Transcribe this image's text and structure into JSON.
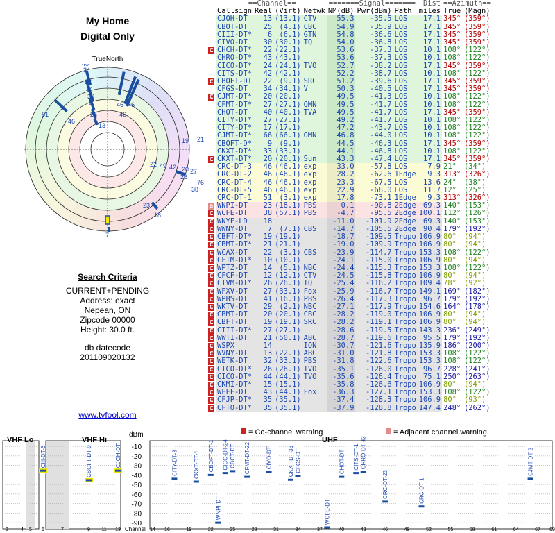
{
  "page": {
    "title": "My Home",
    "subtitle": "Digital Only",
    "compass_label": "TrueNorth",
    "site_link": "www.tvfool.com"
  },
  "criteria": {
    "header": "Search Criteria",
    "lines": [
      "CURRENT+PENDING",
      "Address: exact",
      "Nepean, ON",
      "Zipcode 00000",
      "Height: 30.0 ft."
    ],
    "datecode_label": "db datecode",
    "datecode": "201109020132"
  },
  "table": {
    "group_headers": {
      "channel": "==Channel==",
      "signal": "=======Signal=======",
      "dist": "Dist",
      "azimuth": "==Azimuth=="
    },
    "columns": [
      "Callsign",
      "Real",
      "(Virt)",
      "Netwk",
      "NM(dB)",
      "Pwr(dBm)",
      "Path",
      "miles",
      "True",
      "(Magn)"
    ],
    "rows": [
      {
        "mark": "",
        "color": "green",
        "cs": "CJOH-DT",
        "real": "13",
        "virt": "(13.1)",
        "net": "CTV",
        "nm": "55.3",
        "pwr": "-35.5",
        "path": "LOS",
        "dist": "17.1",
        "az": "345°",
        "mag": "(359°)"
      },
      {
        "mark": "",
        "color": "green",
        "cs": "CBOT-DT",
        "real": "25",
        "virt": "(4.1)",
        "net": "CBC",
        "nm": "54.9",
        "pwr": "-35.9",
        "path": "LOS",
        "dist": "17.1",
        "az": "345°",
        "mag": "(359°)"
      },
      {
        "mark": "",
        "color": "green",
        "cs": "CIII-DT*",
        "real": "6",
        "virt": "(6.1)",
        "net": "GTN",
        "nm": "54.8",
        "pwr": "-36.6",
        "path": "LOS",
        "dist": "17.1",
        "az": "345°",
        "mag": "(359°)"
      },
      {
        "mark": "",
        "color": "green",
        "cs": "CIVO-DT",
        "real": "30",
        "virt": "(30.1)",
        "net": "TQ",
        "nm": "54.0",
        "pwr": "-36.8",
        "path": "LOS",
        "dist": "17.1",
        "az": "345°",
        "mag": "(359°)"
      },
      {
        "mark": "C",
        "color": "green",
        "cs": "CHCH-DT*",
        "real": "22",
        "virt": "(22.1)",
        "net": "",
        "nm": "53.6",
        "pwr": "-37.3",
        "path": "LOS",
        "dist": "10.1",
        "az": "108°",
        "mag": "(122°)"
      },
      {
        "mark": "",
        "color": "green",
        "cs": "CHRO-DT*",
        "real": "43",
        "virt": "(43.1)",
        "net": "",
        "nm": "53.6",
        "pwr": "-37.3",
        "path": "LOS",
        "dist": "10.1",
        "az": "108°",
        "mag": "(122°)"
      },
      {
        "mark": "",
        "color": "green",
        "cs": "CICO-DT*",
        "real": "24",
        "virt": "(24.1)",
        "net": "TVO",
        "nm": "52.7",
        "pwr": "-38.2",
        "path": "LOS",
        "dist": "17.1",
        "az": "345°",
        "mag": "(359°)"
      },
      {
        "mark": "",
        "color": "green",
        "cs": "CITS-DT*",
        "real": "42",
        "virt": "(42.1)",
        "net": "",
        "nm": "52.2",
        "pwr": "-38.7",
        "path": "LOS",
        "dist": "10.1",
        "az": "108°",
        "mag": "(122°)"
      },
      {
        "mark": "C",
        "color": "green",
        "cs": "CBOFT-DT",
        "real": "22",
        "virt": "(9.1)",
        "net": "SRC",
        "nm": "51.2",
        "pwr": "-39.6",
        "path": "LOS",
        "dist": "17.1",
        "az": "345°",
        "mag": "(359°)"
      },
      {
        "mark": "",
        "color": "green",
        "cs": "CFGS-DT",
        "real": "34",
        "virt": "(34.1)",
        "net": "V",
        "nm": "50.3",
        "pwr": "-40.5",
        "path": "LOS",
        "dist": "17.1",
        "az": "345°",
        "mag": "(359°)"
      },
      {
        "mark": "C",
        "color": "green",
        "cs": "CJMT-DT*",
        "real": "20",
        "virt": "(20.1)",
        "net": "",
        "nm": "49.5",
        "pwr": "-41.3",
        "path": "LOS",
        "dist": "10.1",
        "az": "108°",
        "mag": "(122°)"
      },
      {
        "mark": "",
        "color": "green",
        "cs": "CFMT-DT*",
        "real": "27",
        "virt": "(27.1)",
        "net": "OMN",
        "nm": "49.5",
        "pwr": "-41.7",
        "path": "LOS",
        "dist": "10.1",
        "az": "108°",
        "mag": "(122°)"
      },
      {
        "mark": "",
        "color": "green",
        "cs": "CHOT-DT",
        "real": "40",
        "virt": "(40.1)",
        "net": "TVA",
        "nm": "49.5",
        "pwr": "-41.7",
        "path": "LOS",
        "dist": "17.1",
        "az": "345°",
        "mag": "(359°)"
      },
      {
        "mark": "",
        "color": "green",
        "cs": "CITY-DT*",
        "real": "27",
        "virt": "(27.1)",
        "net": "",
        "nm": "49.2",
        "pwr": "-41.7",
        "path": "LOS",
        "dist": "10.1",
        "az": "108°",
        "mag": "(122°)"
      },
      {
        "mark": "",
        "color": "green",
        "cs": "CITY-DT*",
        "real": "17",
        "virt": "(17.1)",
        "net": "",
        "nm": "47.2",
        "pwr": "-43.7",
        "path": "LOS",
        "dist": "10.1",
        "az": "108°",
        "mag": "(122°)"
      },
      {
        "mark": "",
        "color": "green",
        "cs": "CJMT-DT*",
        "real": "66",
        "virt": "(66.1)",
        "net": "OMN",
        "nm": "46.8",
        "pwr": "-44.0",
        "path": "LOS",
        "dist": "10.1",
        "az": "108°",
        "mag": "(122°)"
      },
      {
        "mark": "",
        "color": "green",
        "cs": "CBOFT-D*",
        "real": "9",
        "virt": "(9.1)",
        "net": "",
        "nm": "44.5",
        "pwr": "-46.3",
        "path": "LOS",
        "dist": "17.1",
        "az": "345°",
        "mag": "(359°)"
      },
      {
        "mark": "",
        "color": "green",
        "cs": "CKXT-DT*",
        "real": "33",
        "virt": "(33.1)",
        "net": "",
        "nm": "44.1",
        "pwr": "-46.8",
        "path": "LOS",
        "dist": "10.1",
        "az": "108°",
        "mag": "(122°)"
      },
      {
        "mark": "C",
        "color": "green",
        "cs": "CKXT-DT*",
        "real": "20",
        "virt": "(20.1)",
        "net": "Sun",
        "nm": "43.3",
        "pwr": "-47.4",
        "path": "LOS",
        "dist": "17.1",
        "az": "345°",
        "mag": "(359°)"
      },
      {
        "mark": "",
        "color": "yellow",
        "cs": "CRC-DT-3",
        "real": "46",
        "virt": "(46.1)",
        "net": "exp",
        "nm": "33.0",
        "pwr": "-57.8",
        "path": "LOS",
        "dist": "7.9",
        "az": "21°",
        "mag": "(34°)"
      },
      {
        "mark": "",
        "color": "yellow",
        "cs": "CRC-DT-2",
        "real": "46",
        "virt": "(46.1)",
        "net": "exp",
        "nm": "28.2",
        "pwr": "-62.6",
        "path": "1Edge",
        "dist": "9.3",
        "az": "313°",
        "mag": "(326°)"
      },
      {
        "mark": "",
        "color": "yellow",
        "cs": "CRC-DT-4",
        "real": "46",
        "virt": "(46.1)",
        "net": "exp",
        "nm": "23.3",
        "pwr": "-67.5",
        "path": "LOS",
        "dist": "13.6",
        "az": "24°",
        "mag": "(38°)"
      },
      {
        "mark": "",
        "color": "yellow",
        "cs": "CRC-DT-5",
        "real": "46",
        "virt": "(46.1)",
        "net": "exp",
        "nm": "22.9",
        "pwr": "-68.0",
        "path": "LOS",
        "dist": "11.7",
        "az": "12°",
        "mag": "(25°)"
      },
      {
        "mark": "",
        "color": "yellow",
        "cs": "CRC-DT-1",
        "real": "51",
        "virt": "(3.1)",
        "net": "exp",
        "nm": "17.8",
        "pwr": "-73.1",
        "path": "1Edge",
        "dist": "9.3",
        "az": "313°",
        "mag": "(326°)"
      },
      {
        "mark": "a",
        "color": "pink",
        "cs": "WNPI-DT",
        "real": "23",
        "virt": "(18.1)",
        "net": "PBS",
        "nm": "0.1",
        "pwr": "-90.8",
        "path": "2Edge",
        "dist": "69.3",
        "az": "140°",
        "mag": "(153°)"
      },
      {
        "mark": "C",
        "color": "pink",
        "cs": "WCFE-DT",
        "real": "38",
        "virt": "(57.1)",
        "net": "PBS",
        "nm": "-4.7",
        "pwr": "-95.5",
        "path": "2Edge",
        "dist": "100.1",
        "az": "112°",
        "mag": "(126°)"
      },
      {
        "mark": "C",
        "color": "gray",
        "cs": "WNYF-LD",
        "real": "18",
        "virt": "",
        "net": "",
        "nm": "-11.0",
        "pwr": "-101.9",
        "path": "2Edge",
        "dist": "69.3",
        "az": "140°",
        "mag": "(153°)"
      },
      {
        "mark": "C",
        "color": "gray",
        "cs": "WWNY-DT",
        "real": "7",
        "virt": "(7.1)",
        "net": "CBS",
        "nm": "-14.7",
        "pwr": "-105.5",
        "path": "2Edge",
        "dist": "90.4",
        "az": "179°",
        "mag": "(192°)"
      },
      {
        "mark": "C",
        "color": "gray",
        "cs": "CBFT-DT*",
        "real": "19",
        "virt": "(19.1)",
        "net": "",
        "nm": "-18.7",
        "pwr": "-109.5",
        "path": "Tropo",
        "dist": "106.9",
        "az": "80°",
        "mag": "(94°)"
      },
      {
        "mark": "C",
        "color": "gray",
        "cs": "CBMT-DT*",
        "real": "21",
        "virt": "(21.1)",
        "net": "",
        "nm": "-19.0",
        "pwr": "-109.9",
        "path": "Tropo",
        "dist": "106.9",
        "az": "80°",
        "mag": "(94°)"
      },
      {
        "mark": "C",
        "color": "gray",
        "cs": "WCAX-DT",
        "real": "22",
        "virt": "(3.1)",
        "net": "CBS",
        "nm": "-23.9",
        "pwr": "-114.7",
        "path": "Tropo",
        "dist": "153.3",
        "az": "108°",
        "mag": "(122°)"
      },
      {
        "mark": "C",
        "color": "gray",
        "cs": "CFTM-DT*",
        "real": "10",
        "virt": "(10.1)",
        "net": "",
        "nm": "-24.1",
        "pwr": "-115.0",
        "path": "Tropo",
        "dist": "106.9",
        "az": "80°",
        "mag": "(94°)"
      },
      {
        "mark": "C",
        "color": "gray",
        "cs": "WPTZ-DT",
        "real": "14",
        "virt": "(5.1)",
        "net": "NBC",
        "nm": "-24.4",
        "pwr": "-115.3",
        "path": "Tropo",
        "dist": "153.3",
        "az": "108°",
        "mag": "(122°)"
      },
      {
        "mark": "C",
        "color": "gray",
        "cs": "CFCF-DT",
        "real": "12",
        "virt": "(12.1)",
        "net": "CTV",
        "nm": "-24.5",
        "pwr": "-115.8",
        "path": "Tropo",
        "dist": "106.9",
        "az": "80°",
        "mag": "(94°)"
      },
      {
        "mark": "C",
        "color": "gray",
        "cs": "CIVM-DT*",
        "real": "26",
        "virt": "(26.1)",
        "net": "TQ",
        "nm": "-25.4",
        "pwr": "-116.2",
        "path": "Tropo",
        "dist": "109.4",
        "az": "78°",
        "mag": "(92°)"
      },
      {
        "mark": "C",
        "color": "gray",
        "cs": "WFXV-DT",
        "real": "27",
        "virt": "(33.1)",
        "net": "Fox",
        "nm": "-25.9",
        "pwr": "-116.7",
        "path": "Tropo",
        "dist": "149.1",
        "az": "169°",
        "mag": "(182°)"
      },
      {
        "mark": "C",
        "color": "gray",
        "cs": "WPBS-DT",
        "real": "41",
        "virt": "(16.1)",
        "net": "PBS",
        "nm": "-26.4",
        "pwr": "-117.3",
        "path": "Tropo",
        "dist": "96.7",
        "az": "179°",
        "mag": "(192°)"
      },
      {
        "mark": "C",
        "color": "gray",
        "cs": "WKTV-DT",
        "real": "29",
        "virt": "(2.1)",
        "net": "NBC",
        "nm": "-27.1",
        "pwr": "-117.9",
        "path": "Tropo",
        "dist": "154.6",
        "az": "164°",
        "mag": "(178°)"
      },
      {
        "mark": "C",
        "color": "gray",
        "cs": "CBMT-DT",
        "real": "20",
        "virt": "(20.1)",
        "net": "CBC",
        "nm": "-28.2",
        "pwr": "-119.0",
        "path": "Tropo",
        "dist": "106.9",
        "az": "80°",
        "mag": "(94°)"
      },
      {
        "mark": "C",
        "color": "gray",
        "cs": "CBFT-DT",
        "real": "19",
        "virt": "(19.1)",
        "net": "SRC",
        "nm": "-28.2",
        "pwr": "-119.1",
        "path": "Tropo",
        "dist": "106.9",
        "az": "80°",
        "mag": "(94°)"
      },
      {
        "mark": "C",
        "color": "gray",
        "cs": "CIII-DT*",
        "real": "27",
        "virt": "(27.1)",
        "net": "",
        "nm": "-28.6",
        "pwr": "-119.5",
        "path": "Tropo",
        "dist": "143.3",
        "az": "236°",
        "mag": "(249°)"
      },
      {
        "mark": "C",
        "color": "gray",
        "cs": "WWTI-DT",
        "real": "21",
        "virt": "(50.1)",
        "net": "ABC",
        "nm": "-28.7",
        "pwr": "-119.6",
        "path": "Tropo",
        "dist": "95.5",
        "az": "179°",
        "mag": "(192°)"
      },
      {
        "mark": "C",
        "color": "gray",
        "cs": "WSPX",
        "real": "14",
        "virt": "",
        "net": "ION",
        "nm": "-30.7",
        "pwr": "-121.6",
        "path": "Tropo",
        "dist": "135.9",
        "az": "186°",
        "mag": "(200°)"
      },
      {
        "mark": "C",
        "color": "gray",
        "cs": "WVNY-DT",
        "real": "13",
        "virt": "(22.1)",
        "net": "ABC",
        "nm": "-31.0",
        "pwr": "-121.8",
        "path": "Tropo",
        "dist": "153.3",
        "az": "108°",
        "mag": "(122°)"
      },
      {
        "mark": "C",
        "color": "gray",
        "cs": "WETK-DT",
        "real": "32",
        "virt": "(33.1)",
        "net": "PBS",
        "nm": "-31.8",
        "pwr": "-122.6",
        "path": "Tropo",
        "dist": "153.3",
        "az": "108°",
        "mag": "(122°)"
      },
      {
        "mark": "C",
        "color": "gray",
        "cs": "CICO-DT*",
        "real": "26",
        "virt": "(26.1)",
        "net": "TVO",
        "nm": "-35.1",
        "pwr": "-126.0",
        "path": "Tropo",
        "dist": "96.7",
        "az": "228°",
        "mag": "(241°)"
      },
      {
        "mark": "C",
        "color": "gray",
        "cs": "CICO-DT*",
        "real": "44",
        "virt": "(44.1)",
        "net": "TVO",
        "nm": "-35.6",
        "pwr": "-126.4",
        "path": "Tropo",
        "dist": "75.1",
        "az": "250°",
        "mag": "(263°)"
      },
      {
        "mark": "C",
        "color": "gray",
        "cs": "CKMI-DT*",
        "real": "15",
        "virt": "(15.1)",
        "net": "",
        "nm": "-35.8",
        "pwr": "-126.6",
        "path": "Tropo",
        "dist": "106.9",
        "az": "80°",
        "mag": "(94°)"
      },
      {
        "mark": "C",
        "color": "gray",
        "cs": "WFFF-DT",
        "real": "43",
        "virt": "(44.1)",
        "net": "Fox",
        "nm": "-36.3",
        "pwr": "-127.1",
        "path": "Tropo",
        "dist": "153.3",
        "az": "108°",
        "mag": "(122°)"
      },
      {
        "mark": "C",
        "color": "gray",
        "cs": "CFJP-DT*",
        "real": "35",
        "virt": "(35.1)",
        "net": "",
        "nm": "-37.4",
        "pwr": "-128.3",
        "path": "Tropo",
        "dist": "106.9",
        "az": "80°",
        "mag": "(93°)"
      },
      {
        "mark": "C",
        "color": "gray",
        "cs": "CFTO-DT*",
        "real": "35",
        "virt": "(35.1)",
        "net": "",
        "nm": "-37.9",
        "pwr": "-128.8",
        "path": "Tropo",
        "dist": "147.4",
        "az": "248°",
        "mag": "(262°)"
      }
    ]
  },
  "colors": {
    "az_345": "#b00000",
    "az_108": "#208020",
    "az_far": "#1a1aa0",
    "az_80": "#7fa000",
    "link": "#0000cc",
    "bar": "#1a4fa0",
    "highlight": "#f2e400"
  },
  "radar": {
    "compass_label": "TrueNorth",
    "labels": [
      "40",
      "34",
      "22",
      "24",
      "30",
      "6",
      "25",
      "13",
      "46",
      "46",
      "46",
      "51",
      "46",
      "19",
      "21",
      "22",
      "49",
      "42",
      "20",
      "27",
      "26",
      "76",
      "38",
      "23",
      "18",
      "7"
    ]
  },
  "chart_data": {
    "type": "bar",
    "title": "",
    "legend": {
      "cochannel": "= Co-channel warning",
      "adjacent": "= Adjacent channel warning"
    },
    "bands": {
      "vhf_lo": "VHF Lo",
      "vhf_hi": "VHF Hi",
      "uhf": "UHF"
    },
    "ylabel": "dBm",
    "xlabel": "Channel",
    "y_ticks": [
      "-10",
      "-20",
      "-30",
      "-40",
      "-50",
      "-60",
      "-70",
      "-80",
      "-90"
    ],
    "ylim": [
      -95,
      -7
    ],
    "x_ticks_vhf": [
      "2",
      "4",
      "5",
      "6",
      "7",
      "9",
      "11",
      "13"
    ],
    "x_ticks_uhf": [
      "14",
      "16",
      "19",
      "22",
      "25",
      "28",
      "31",
      "34",
      "37",
      "40",
      "43",
      "46",
      "49",
      "52",
      "55",
      "58",
      "61",
      "64",
      "67",
      "69"
    ],
    "stations": [
      {
        "label": "CIII-DT-6",
        "channel": 6,
        "pwr": -35.5,
        "highlight": true
      },
      {
        "label": "CBOFT-DT-9",
        "channel": 9,
        "pwr": -45.5,
        "highlight": true
      },
      {
        "label": "CJOH-DT",
        "channel": 13,
        "pwr": -35.5,
        "highlight": true
      },
      {
        "label": "CITY-DT-3",
        "channel": 17,
        "pwr": -44.0
      },
      {
        "label": "CKXT-DT-1",
        "channel": 20,
        "pwr": -47.0
      },
      {
        "label": "CBOFT-DT-1",
        "channel": 22,
        "pwr": -40.0
      },
      {
        "label": "CICO-DT-24",
        "channel": 24,
        "pwr": -38.0
      },
      {
        "label": "CBOT-DT",
        "channel": 25,
        "pwr": -36.0
      },
      {
        "label": "WNPI-DT",
        "channel": 23,
        "pwr": -90.0
      },
      {
        "label": "CFMT-DT-22",
        "channel": 27,
        "pwr": -42.0
      },
      {
        "label": "CIVO-DT",
        "channel": 30,
        "pwr": -37.0
      },
      {
        "label": "CKXT-DT-33",
        "channel": 33,
        "pwr": -45.0
      },
      {
        "label": "CFGS-DT",
        "channel": 34,
        "pwr": -41.0
      },
      {
        "label": "WCFE-DT",
        "channel": 38,
        "pwr": -95.0
      },
      {
        "label": "CHOT-DT",
        "channel": 40,
        "pwr": -42.0
      },
      {
        "label": "CITS-DT-1",
        "channel": 42,
        "pwr": -38.0
      },
      {
        "label": "CHRO-DT-43",
        "channel": 43,
        "pwr": -37.0
      },
      {
        "label": "CRC-DT-23",
        "channel": 46,
        "pwr": -68.0
      },
      {
        "label": "CRC-DT-1",
        "channel": 51,
        "pwr": -73.0
      },
      {
        "label": "CJMT-DT-2",
        "channel": 66,
        "pwr": -44.0
      }
    ]
  }
}
